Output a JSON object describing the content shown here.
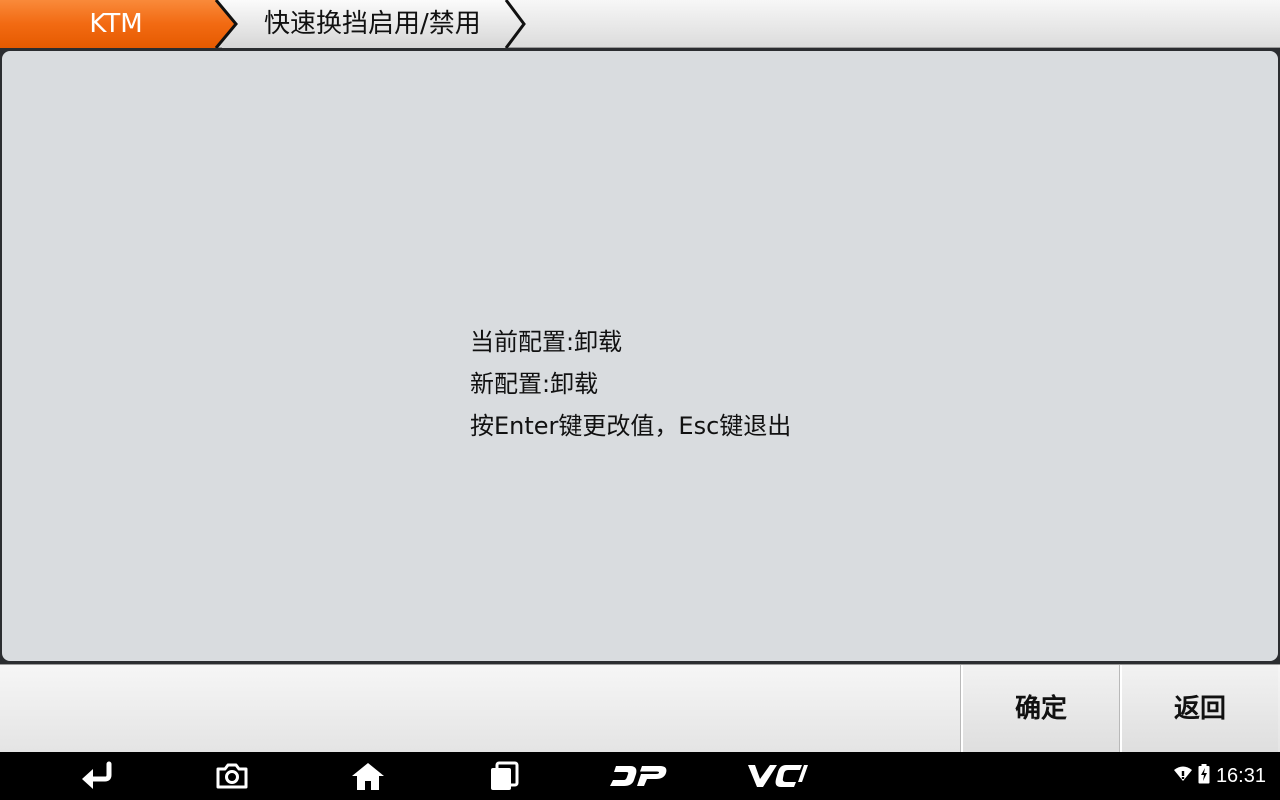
{
  "breadcrumb": {
    "brand": "KTM",
    "feature": "快速换挡启用/禁用"
  },
  "message": {
    "current_config": "当前配置:卸载",
    "new_config": "新配置:卸载",
    "instruction": "按Enter键更改值，Esc键退出"
  },
  "actions": {
    "confirm_label": "确定",
    "back_label": "返回"
  },
  "navbar": {
    "icons": [
      "back-icon",
      "camera-icon",
      "home-icon",
      "recent-apps-icon",
      "dp-logo-icon",
      "vci-logo-icon"
    ],
    "dp_text": "DP",
    "vci_text": "VCI"
  },
  "status": {
    "time": "16:31",
    "icons": [
      "wifi-icon",
      "battery-charging-icon"
    ]
  },
  "colors": {
    "accent_orange": "#f26a12",
    "panel_bg": "#d9dcdf",
    "nav_bg": "#000000"
  }
}
